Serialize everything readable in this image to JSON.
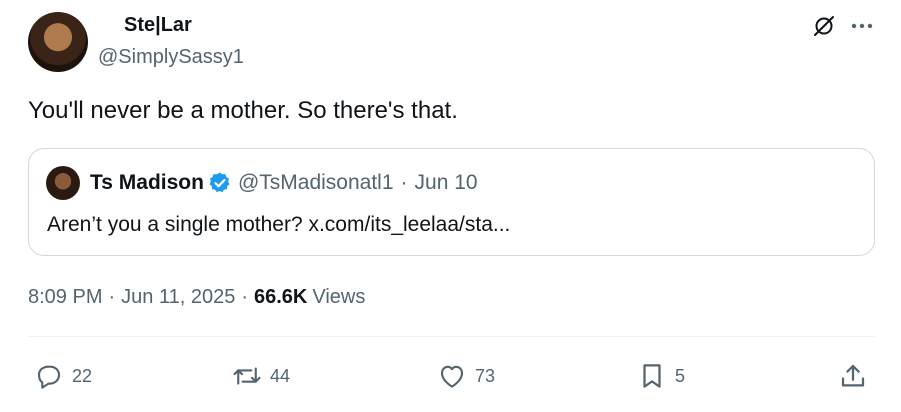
{
  "tweet": {
    "author": {
      "name": "Ste|Lar",
      "handle": "@SimplySassy1"
    },
    "text": "You'll never be a mother. So there's that.",
    "quote": {
      "name": "Ts Madison",
      "handle": "@TsMadisonatl1",
      "separator": "·",
      "date": "Jun 10",
      "text": "Aren’t you a single mother? x.com/its_leelaa/sta..."
    },
    "meta": {
      "time": "8:09 PM",
      "dot1": "·",
      "date": "Jun 11, 2025",
      "dot2": "·",
      "views_count": "66.6K",
      "views_label": "Views"
    },
    "actions": {
      "replies": "22",
      "reposts": "44",
      "likes": "73",
      "bookmarks": "5"
    }
  },
  "icons": {
    "top_right": [
      "grok-icon",
      "more-icon"
    ],
    "actions": [
      "reply-icon",
      "repost-icon",
      "like-icon",
      "bookmark-icon",
      "share-icon"
    ]
  },
  "colors": {
    "verified": "#1d9bf0",
    "secondary_text": "#536471",
    "border": "#cfd9de"
  }
}
